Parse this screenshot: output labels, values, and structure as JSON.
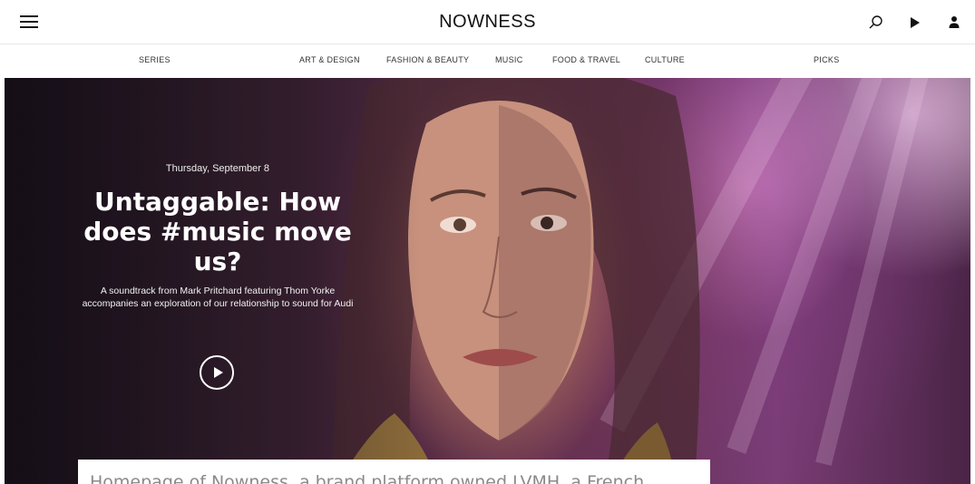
{
  "header": {
    "logo": "NOWNESS",
    "icons": [
      "menu-icon",
      "search-icon",
      "play-icon",
      "user-icon"
    ]
  },
  "nav": {
    "items": [
      "SERIES",
      "ART & DESIGN",
      "FASHION & BEAUTY",
      "MUSIC",
      "FOOD & TRAVEL",
      "CULTURE",
      "PICKS"
    ]
  },
  "hero": {
    "date": "Thursday, September 8",
    "title": "Untaggable: How does #music move us?",
    "subtitle": "A soundtrack from Mark Pritchard featuring Thom Yorke accompanies an exploration of our relationship to sound for Audi",
    "play_icon": "play-circle-icon"
  },
  "caption": {
    "text": "Homepage of Nowness, a brand platform owned LVMH, a French"
  },
  "colors": {
    "hero_purple": "#5c2e55",
    "hero_pink": "#c878be",
    "text_dark": "#111111",
    "caption_text": "#8a8a8a"
  }
}
